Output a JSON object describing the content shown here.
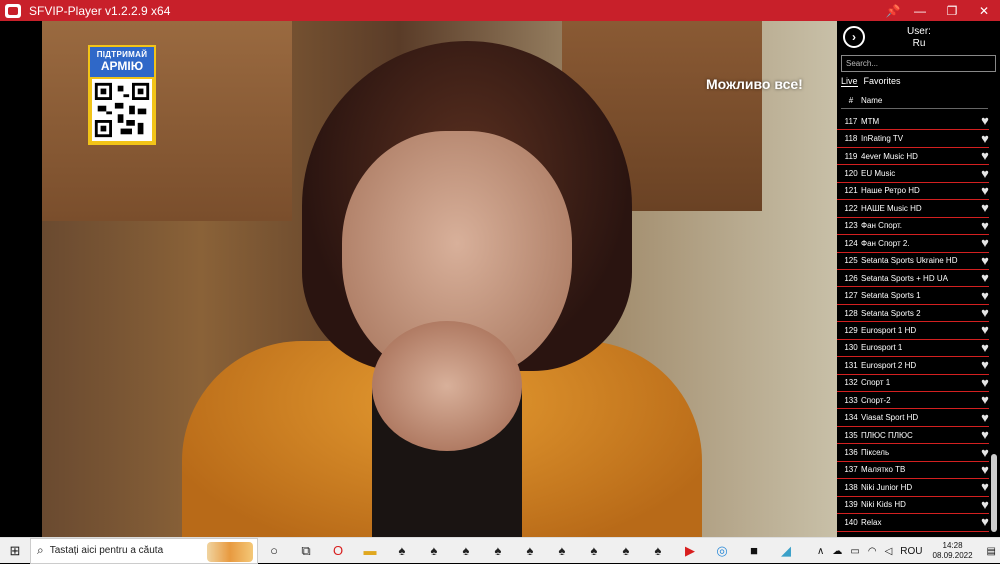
{
  "window": {
    "title": "SFVIP-Player v1.2.2.9 x64",
    "controls": {
      "pin": "📌",
      "minimize": "—",
      "maximize": "❐",
      "close": "✕"
    }
  },
  "video": {
    "banner": {
      "line1": "ПІДТРИМАЙ",
      "line2": "АРМІЮ"
    },
    "overlay_text": "Можливо все!"
  },
  "sidebar": {
    "next_icon": "›",
    "user_label": "User:",
    "user_name": "Ru",
    "search_placeholder": "Search...",
    "tabs": [
      {
        "label": "Live",
        "active": true
      },
      {
        "label": "Favorites",
        "active": false
      }
    ],
    "col_num": "#",
    "col_name": "Name",
    "channels": [
      {
        "num": "117",
        "name": "MTM"
      },
      {
        "num": "118",
        "name": "InRating TV"
      },
      {
        "num": "119",
        "name": "4ever Music HD"
      },
      {
        "num": "120",
        "name": "EU Music"
      },
      {
        "num": "121",
        "name": "Наше Ретро HD"
      },
      {
        "num": "122",
        "name": "НАШЕ Music HD"
      },
      {
        "num": "123",
        "name": "Фан Спорт."
      },
      {
        "num": "124",
        "name": "Фан Спорт 2."
      },
      {
        "num": "125",
        "name": "Setanta Sports Ukraine HD"
      },
      {
        "num": "126",
        "name": "Setanta Sports + HD UA"
      },
      {
        "num": "127",
        "name": "Setanta Sports 1"
      },
      {
        "num": "128",
        "name": "Setanta Sports 2"
      },
      {
        "num": "129",
        "name": "Eurosport 1 HD"
      },
      {
        "num": "130",
        "name": "Eurosport 1"
      },
      {
        "num": "131",
        "name": "Eurosport 2 HD"
      },
      {
        "num": "132",
        "name": "Спорт 1"
      },
      {
        "num": "133",
        "name": "Спорт-2"
      },
      {
        "num": "134",
        "name": "Viasat Sport HD"
      },
      {
        "num": "135",
        "name": "ПЛЮС ПЛЮС"
      },
      {
        "num": "136",
        "name": "Піксель"
      },
      {
        "num": "137",
        "name": "Малятко ТВ"
      },
      {
        "num": "138",
        "name": "Niki Junior HD"
      },
      {
        "num": "139",
        "name": "Niki Kids HD"
      },
      {
        "num": "140",
        "name": "Relax"
      }
    ],
    "fav_icon": "♥"
  },
  "taskbar": {
    "start_icon": "⊞",
    "search_text": "Tastați aici pentru a căuta",
    "search_icon": "⌕",
    "pinned": [
      {
        "name": "task-view-icon",
        "glyph": "○",
        "color": "#222222"
      },
      {
        "name": "window-icon",
        "glyph": "⧉",
        "color": "#222222"
      },
      {
        "name": "opera-icon",
        "glyph": "O",
        "color": "#d81e1e"
      },
      {
        "name": "folder-icon",
        "glyph": "▬",
        "color": "#e0a820"
      },
      {
        "name": "spy-icon-1",
        "glyph": "♠",
        "color": "#222222"
      },
      {
        "name": "spy-icon-2",
        "glyph": "♠",
        "color": "#222222"
      },
      {
        "name": "spy-icon-3",
        "glyph": "♠",
        "color": "#222222"
      },
      {
        "name": "spy-icon-4",
        "glyph": "♠",
        "color": "#222222"
      },
      {
        "name": "spy-icon-5",
        "glyph": "♠",
        "color": "#222222"
      },
      {
        "name": "spy-icon-6",
        "glyph": "♠",
        "color": "#222222"
      },
      {
        "name": "spy-icon-7",
        "glyph": "♠",
        "color": "#222222"
      },
      {
        "name": "spy-icon-8",
        "glyph": "♠",
        "color": "#222222"
      },
      {
        "name": "spy-icon-9",
        "glyph": "♠",
        "color": "#222222"
      },
      {
        "name": "player-icon",
        "glyph": "▶",
        "color": "#d81e1e"
      },
      {
        "name": "sfvip-icon",
        "glyph": "◎",
        "color": "#2a8ad8"
      },
      {
        "name": "terminal-icon",
        "glyph": "■",
        "color": "#111111"
      },
      {
        "name": "app-icon",
        "glyph": "◢",
        "color": "#3aa0c8"
      }
    ],
    "tray": {
      "chevron": "∧",
      "lang": "ROU",
      "time": "14:28",
      "date": "08.09.2022",
      "notif": "▤"
    }
  },
  "colors": {
    "titlebar": "#c8202a",
    "row_separator": "#d32020"
  }
}
